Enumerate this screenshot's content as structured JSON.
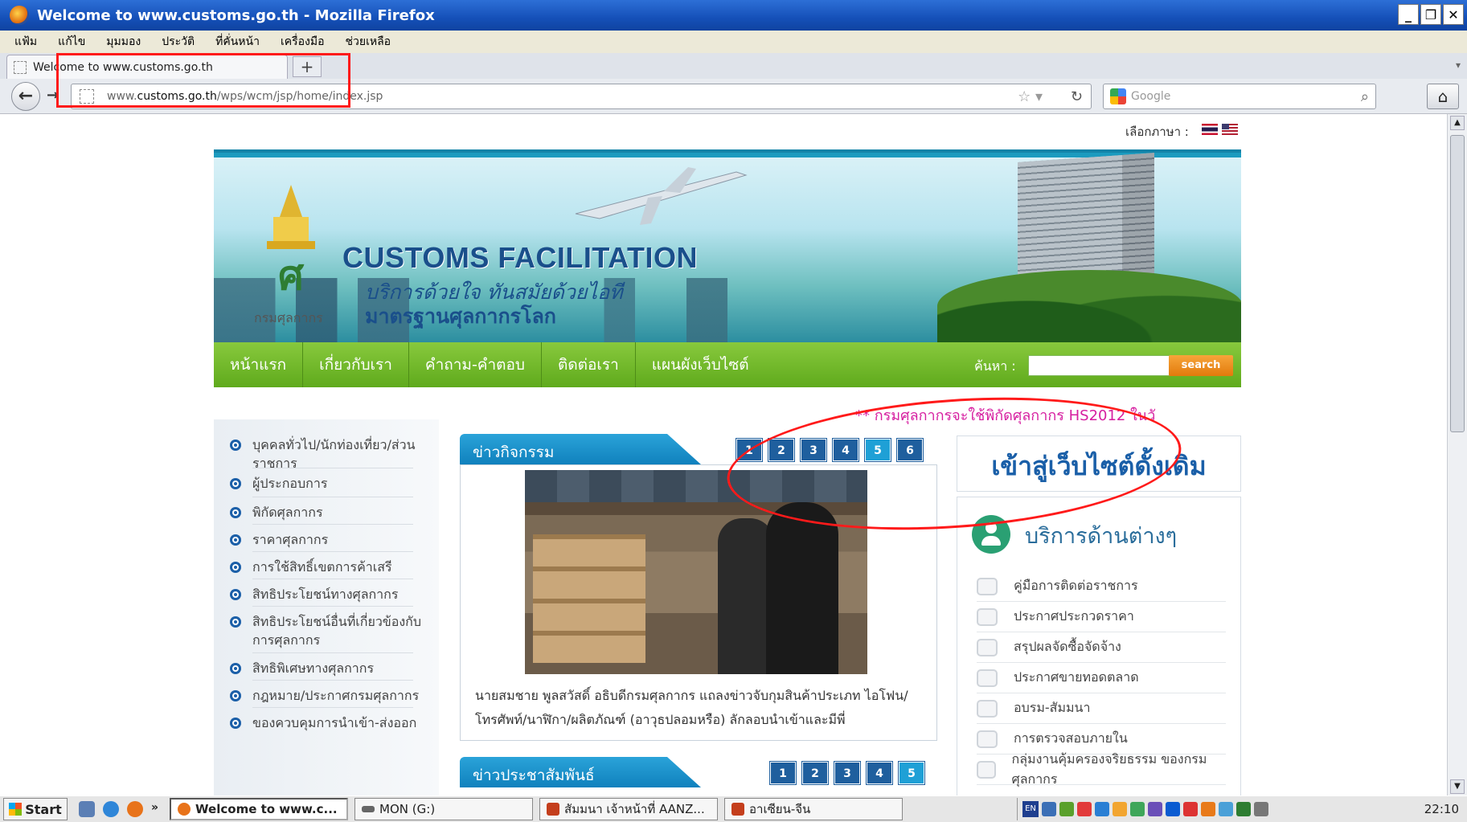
{
  "window": {
    "title": "Welcome to www.customs.go.th - Mozilla Firefox",
    "controls": [
      "_",
      "❐",
      "✕"
    ]
  },
  "menubar": [
    "แฟ้ม",
    "แก้ไข",
    "มุมมอง",
    "ประวัติ",
    "ที่คั่นหน้า",
    "เครื่องมือ",
    "ช่วยเหลือ"
  ],
  "tab": {
    "title": "Welcome to www.customs.go.th",
    "new_tab": "+"
  },
  "address": {
    "prefix": "www.",
    "domain": "customs.go.th",
    "path": "/wps/wcm/jsp/home/index.jsp"
  },
  "search": {
    "placeholder": "Google",
    "engine_icon": "google-icon"
  },
  "page": {
    "language_label": "เลือกภาษา :",
    "banner": {
      "dept_name": "กรมศุลกากร",
      "headline": "CUSTOMS FACILITATION",
      "sub1": "บริการด้วยใจ ทันสมัยด้วยไอที",
      "sub2": "มาตรฐานศุลกากรโลก"
    },
    "nav": [
      "หน้าแรก",
      "เกี่ยวกับเรา",
      "คำถาม-คำตอบ",
      "ติดต่อเรา",
      "แผนผังเว็บไซต์"
    ],
    "site_search": {
      "label": "ค้นหา :",
      "button": "search"
    },
    "marquee": "** กรมศุลกากรจะใช้พิกัดศุลกากร HS2012 ในวั",
    "left_menu": [
      "บุคคลทั่วไป/นักท่องเที่ยว/ส่วนราชการ",
      "ผู้ประกอบการ",
      "พิกัดศุลกากร",
      "ราคาศุลกากร",
      "การใช้สิทธิ์เขตการค้าเสรี",
      "สิทธิประโยชน์ทางศุลกากร",
      "สิทธิประโยชน์อื่นที่เกี่ยวข้องกับการศุลกากร",
      "สิทธิพิเศษทางศุลกากร",
      "กฎหมาย/ประกาศกรมศุลกากร",
      "ของควบคุมการนำเข้า-ส่งออก"
    ],
    "news": {
      "heading": "ข่าวกิจกรรม",
      "pages": [
        "1",
        "2",
        "3",
        "4",
        "5",
        "6"
      ],
      "active_page": "5",
      "caption": "นายสมชาย พูลสวัสดิ์ อธิบดีกรมศุลกากร แถลงข่าวจับกุมสินค้าประเภท ไอโฟน/โทรศัพท์/นาฬิกา/ผลิตภัณฑ์ (อาวุธปลอมหรือ) ลักลอบนำเข้าและมีพี่"
    },
    "pr": {
      "heading": "ข่าวประชาสัมพันธ์",
      "pages": [
        "1",
        "2",
        "3",
        "4",
        "5"
      ]
    },
    "old_site": "เข้าสู่เว็บไซต์ดั้งเดิม",
    "services": {
      "title": "บริการด้านต่างๆ",
      "items": [
        "คู่มือการติดต่อราชการ",
        "ประกาศประกวดราคา",
        "สรุปผลจัดซื้อจัดจ้าง",
        "ประกาศขายทอดตลาด",
        "อบรม-สัมมนา",
        "การตรวจสอบภายใน",
        "กลุ่มงานคุ้มครองจริยธรรม ของกรมศุลกากร"
      ]
    }
  },
  "taskbar": {
    "start": "Start",
    "more": "»",
    "tasks": [
      "Welcome to www.c...",
      "MON (G:)",
      "สัมมนา เจ้าหน้าที่ AANZ...",
      "อาเซียน-จีน"
    ],
    "lang": "EN",
    "clock": "22:10"
  },
  "colors": {
    "nav_green": "#6fb62a",
    "news_blue": "#1a8fca",
    "annotation_red": "#ff1a1a",
    "marquee_pink": "#d61ea0"
  }
}
